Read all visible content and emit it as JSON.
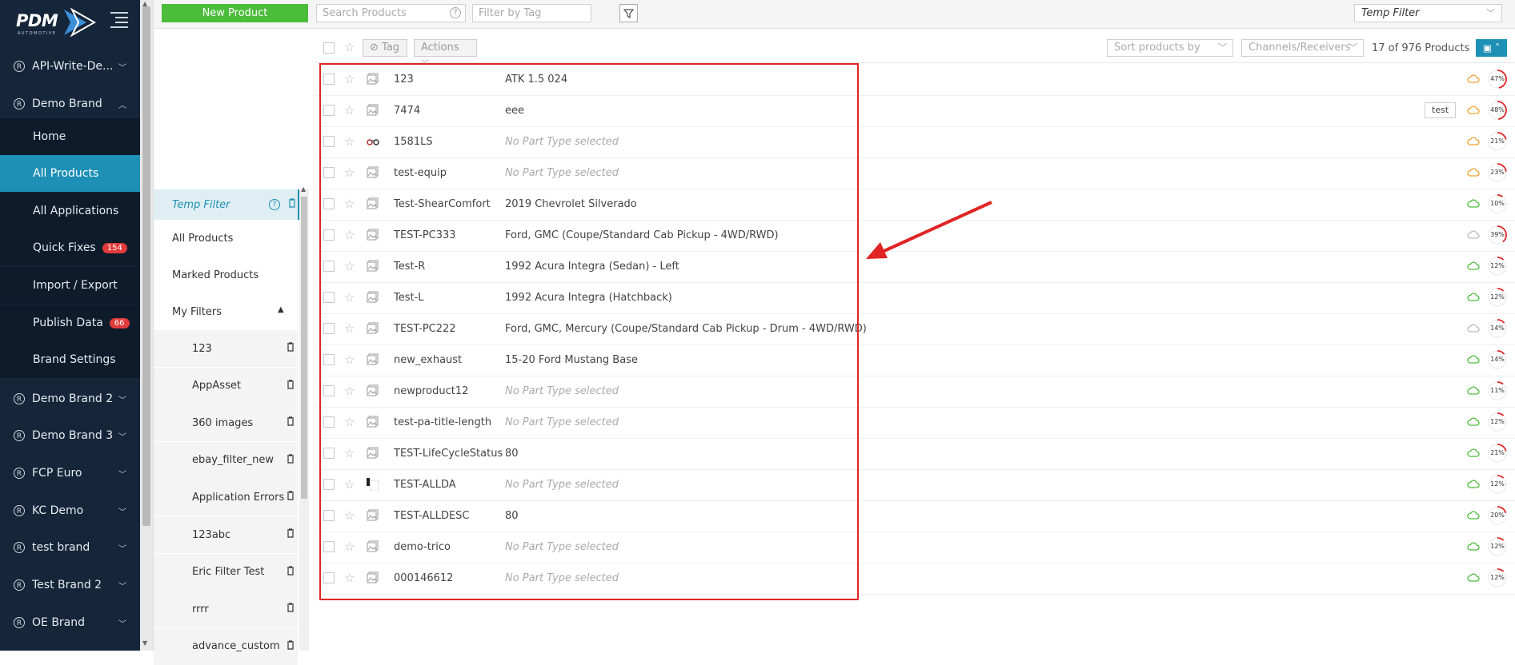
{
  "app": {
    "logo_text": "PDM",
    "logo_sub": "AUTOMOTIVE"
  },
  "nav": {
    "items": [
      {
        "label": "API-Write-De...",
        "top": 0
      },
      {
        "label": "Demo Brand"
      },
      {
        "label": "Demo Brand 2"
      },
      {
        "label": "Demo Brand 3"
      },
      {
        "label": "FCP Euro"
      },
      {
        "label": "KC Demo"
      },
      {
        "label": "test brand"
      },
      {
        "label": "Test Brand 2"
      },
      {
        "label": "OE Brand"
      }
    ],
    "sub": [
      {
        "label": "Home"
      },
      {
        "label": "All Products"
      },
      {
        "label": "All Applications"
      },
      {
        "label": "Quick Fixes",
        "badge": "154"
      },
      {
        "label": "Import / Export"
      },
      {
        "label": "Publish Data",
        "badge": "66"
      },
      {
        "label": "Brand Settings"
      }
    ]
  },
  "topbar": {
    "new_product": "New Product",
    "search_placeholder": "Search Products",
    "tag_placeholder": "Filter by Tag",
    "filter_select": "Temp Filter"
  },
  "filters": {
    "temp": "Temp Filter",
    "all_products": "All Products",
    "marked_products": "Marked Products",
    "my_filters": "My Filters",
    "saved": [
      "123",
      "AppAsset",
      "360 images",
      "ebay_filter_new",
      "Application Errors",
      "123abc",
      "Eric Filter Test",
      "rrrr",
      "advance_custom"
    ]
  },
  "toolbar": {
    "tag": "Tag",
    "actions": "Actions",
    "sort": "Sort products by",
    "channels": "Channels/Receivers",
    "count": "17 of 976 Products"
  },
  "products": [
    {
      "id": "123",
      "desc": "ATK 1.5 024",
      "none": false,
      "tag": "",
      "cloud": "#f0a030",
      "pct": 47
    },
    {
      "id": "7474",
      "desc": "eee",
      "none": false,
      "tag": "test",
      "cloud": "#f0a030",
      "pct": 48
    },
    {
      "id": "1581LS",
      "desc": "No Part Type selected",
      "none": true,
      "tag": "",
      "cloud": "#f0a030",
      "pct": 21
    },
    {
      "id": "test-equip",
      "desc": "No Part Type selected",
      "none": true,
      "tag": "",
      "cloud": "#f0a030",
      "pct": 23
    },
    {
      "id": "Test-ShearComfort",
      "desc": "2019 Chevrolet Silverado",
      "none": false,
      "tag": "",
      "cloud": "#4cbc3b",
      "pct": 10
    },
    {
      "id": "TEST-PC333",
      "desc": "Ford, GMC (Coupe/Standard Cab Pickup - 4WD/RWD)",
      "none": false,
      "tag": "",
      "cloud": "#bbbbbb",
      "pct": 39
    },
    {
      "id": "Test-R",
      "desc": "1992 Acura Integra (Sedan) - Left",
      "none": false,
      "tag": "",
      "cloud": "#4cbc3b",
      "pct": 12
    },
    {
      "id": "Test-L",
      "desc": "1992 Acura Integra (Hatchback)",
      "none": false,
      "tag": "",
      "cloud": "#4cbc3b",
      "pct": 12
    },
    {
      "id": "TEST-PC222",
      "desc": "Ford, GMC, Mercury (Coupe/Standard Cab Pickup - Drum - 4WD/RWD)",
      "none": false,
      "tag": "",
      "cloud": "#bbbbbb",
      "pct": 14
    },
    {
      "id": "new_exhaust",
      "desc": "15-20 Ford Mustang Base",
      "none": false,
      "tag": "",
      "cloud": "#4cbc3b",
      "pct": 14
    },
    {
      "id": "newproduct12",
      "desc": "No Part Type selected",
      "none": true,
      "tag": "",
      "cloud": "#4cbc3b",
      "pct": 11
    },
    {
      "id": "test-pa-title-length",
      "desc": "No Part Type selected",
      "none": true,
      "tag": "",
      "cloud": "#4cbc3b",
      "pct": 12
    },
    {
      "id": "TEST-LifeCycleStatus",
      "desc": "80",
      "none": false,
      "tag": "",
      "cloud": "#4cbc3b",
      "pct": 21
    },
    {
      "id": "TEST-ALLDA",
      "desc": "No Part Type selected",
      "none": true,
      "tag": "",
      "cloud": "#4cbc3b",
      "pct": 12
    },
    {
      "id": "TEST-ALLDESC",
      "desc": "80",
      "none": false,
      "tag": "",
      "cloud": "#4cbc3b",
      "pct": 20
    },
    {
      "id": "demo-trico",
      "desc": "No Part Type selected",
      "none": true,
      "tag": "",
      "cloud": "#4cbc3b",
      "pct": 12
    },
    {
      "id": "000146612",
      "desc": "No Part Type selected",
      "none": true,
      "tag": "",
      "cloud": "#4cbc3b",
      "pct": 12
    }
  ],
  "colors": {
    "accent": "#1e8fb5",
    "nav_bg": "#15263a",
    "primary_button": "#4cbc3b",
    "annotation": "#e02424"
  }
}
